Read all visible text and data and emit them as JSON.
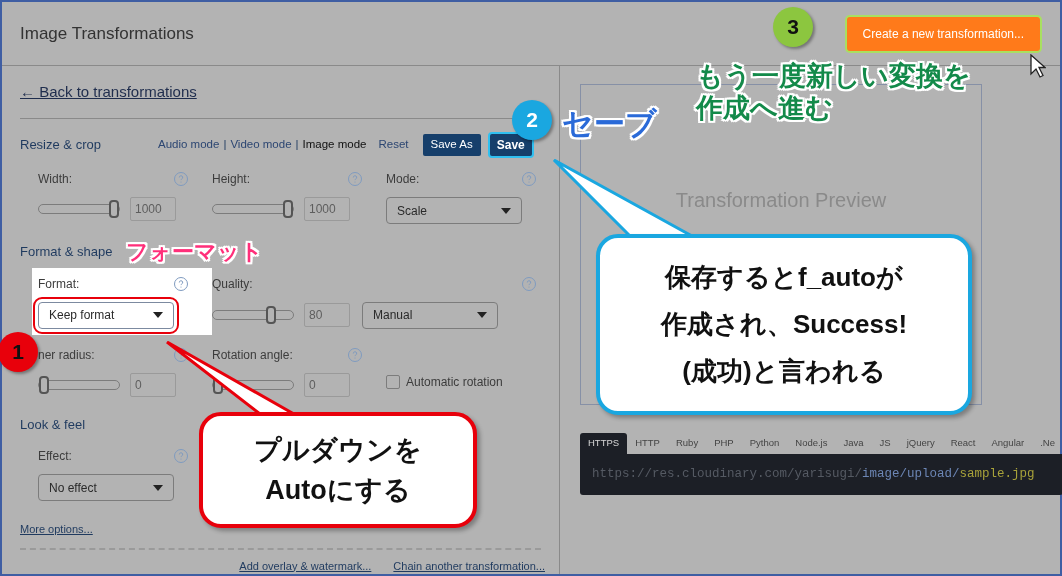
{
  "header": {
    "title": "Image Transformations",
    "create_button": {
      "label": "Create a new transformation...",
      "highlighted": true
    }
  },
  "back_link": "← Back to transformations",
  "resize_crop": {
    "title": "Resize & crop",
    "modes": [
      {
        "label": "Audio mode",
        "selected": false
      },
      {
        "label": "Video mode",
        "selected": false
      },
      {
        "label": "Image mode",
        "selected": true
      }
    ],
    "separator": "|",
    "reset": "Reset",
    "save_as": "Save As",
    "save": {
      "label": "Save",
      "highlighted": true
    },
    "fields": [
      {
        "kind": "slider",
        "label": "Width:",
        "level": 1,
        "value": "1000"
      },
      {
        "kind": "slider",
        "label": "Height:",
        "level": 1,
        "value": "1000"
      },
      {
        "kind": "select",
        "label": "Mode:",
        "value": "Scale"
      }
    ]
  },
  "format_shape": {
    "title": "Format & shape",
    "fields": [
      {
        "kind": "select",
        "label": "Format:",
        "value": "Keep format",
        "highlighted": true
      },
      {
        "kind": "slider_select",
        "label": "Quality:",
        "level": 0.75,
        "value": "80",
        "select": "Manual"
      },
      {
        "kind": "slider",
        "label": "ner radius:",
        "level": 0,
        "value": "0"
      },
      {
        "kind": "slider",
        "label": "Rotation angle:",
        "level": 0,
        "value": "0"
      },
      {
        "kind": "checkbox",
        "label": "Automatic rotation",
        "checked": false
      }
    ]
  },
  "look_feel": {
    "title": "Look & feel",
    "fields": [
      {
        "kind": "select",
        "label": "Effect:",
        "value": "No effect"
      }
    ]
  },
  "more_options": "More options...",
  "footer_links": [
    "Add overlay & watermark...",
    "Chain another transformation..."
  ],
  "preview": {
    "placeholder": "Transformation Preview"
  },
  "code": {
    "tabs": [
      {
        "label": "HTTPS",
        "selected": true
      },
      {
        "label": "HTTP",
        "selected": false
      },
      {
        "label": "Ruby",
        "selected": false
      },
      {
        "label": "PHP",
        "selected": false
      },
      {
        "label": "Python",
        "selected": false
      },
      {
        "label": "Node.js",
        "selected": false
      },
      {
        "label": "Java",
        "selected": false
      },
      {
        "label": "JS",
        "selected": false
      },
      {
        "label": "jQuery",
        "selected": false
      },
      {
        "label": "React",
        "selected": false
      },
      {
        "label": "Angular",
        "selected": false
      },
      {
        "label": ".Ne",
        "selected": false
      }
    ],
    "url_parts": [
      {
        "kind": "base",
        "text": "https://res.cloudinary.com/yarisugi/"
      },
      {
        "kind": "path",
        "text": "image/upload/"
      },
      {
        "kind": "file",
        "text": "sample.jpg"
      }
    ]
  },
  "annotations": {
    "steps": [
      {
        "number": "1",
        "color": "#e8000b"
      },
      {
        "number": "2",
        "color": "#1aa7e0"
      },
      {
        "number": "3",
        "color": "#8cc63f"
      }
    ],
    "labels": [
      {
        "lines": [
          "フォーマット"
        ],
        "color": "#ff2f7a"
      },
      {
        "lines": [
          "セーブ"
        ],
        "color": "#2a6ad8"
      },
      {
        "lines": [
          "もう一度新しい変換を",
          "作成へ進む"
        ],
        "color": "#138a4a"
      }
    ],
    "callouts": [
      {
        "lines": [
          "プルダウンを",
          "Autoにする"
        ],
        "color": "#e8000b"
      },
      {
        "lines": [
          "保存するとf_autoが",
          "作成され、Success!",
          "(成功)と言われる"
        ],
        "color": "#1aa7e0"
      }
    ]
  }
}
